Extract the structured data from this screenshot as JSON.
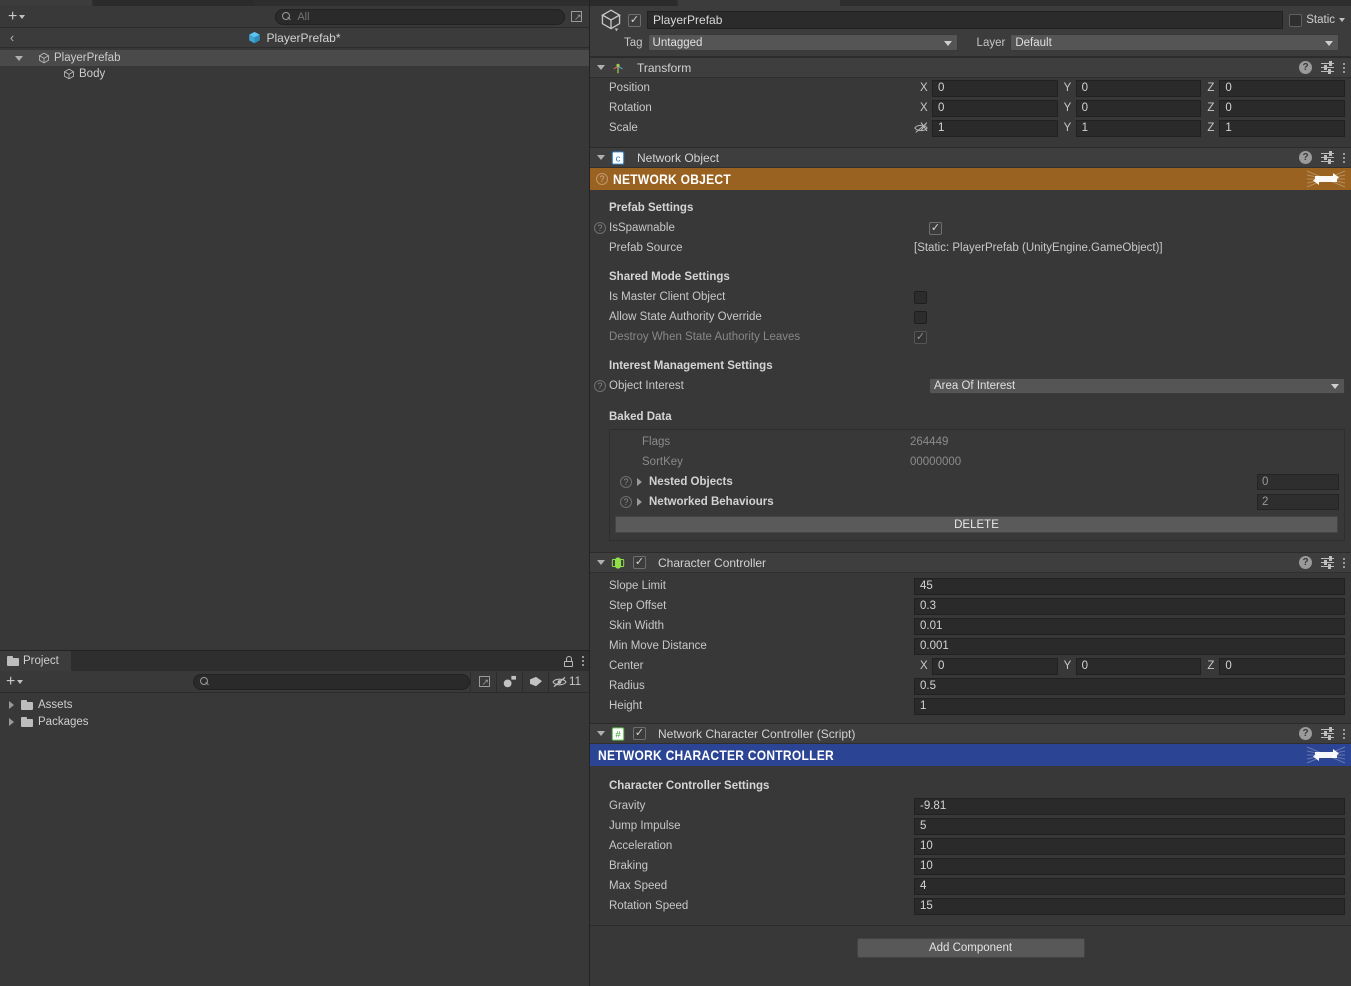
{
  "hierarchy": {
    "search_placeholder": "All",
    "prefab_title": "PlayerPrefab*",
    "back_label": "‹",
    "rows": [
      {
        "label": "PlayerPrefab",
        "icon": "cube-icon",
        "selected": true,
        "expanded": true
      },
      {
        "label": "Body",
        "icon": "cube-icon",
        "selected": false,
        "expanded": false
      }
    ]
  },
  "project": {
    "tab_label": "Project",
    "search_placeholder": "",
    "hidden_count": "11",
    "rows": [
      {
        "label": "Assets"
      },
      {
        "label": "Packages"
      }
    ]
  },
  "inspector": {
    "gameobject": {
      "name": "PlayerPrefab",
      "enabled": true,
      "static_label": "Static",
      "static_checked": false,
      "tag_label": "Tag",
      "tag_value": "Untagged",
      "layer_label": "Layer",
      "layer_value": "Default"
    },
    "components": [
      {
        "id": "transform",
        "title": "Transform",
        "icon": "transform-icon",
        "has_checkbox": false,
        "rows": [
          {
            "label": "Position",
            "type": "vec3",
            "x": "0",
            "y": "0",
            "z": "0"
          },
          {
            "label": "Rotation",
            "type": "vec3",
            "x": "0",
            "y": "0",
            "z": "0"
          },
          {
            "label": "Scale",
            "type": "vec3",
            "x": "1",
            "y": "1",
            "z": "1",
            "lock_icon": true
          }
        ]
      },
      {
        "id": "network-object",
        "title": "Network Object",
        "icon": "script-blue-icon",
        "has_checkbox": false,
        "band": {
          "text": "NETWORK OBJECT",
          "color": "#9a6220",
          "logo": "fusion-logo-icon"
        },
        "groups": [
          {
            "heading": "Prefab Settings",
            "rows": [
              {
                "label": "IsSpawnable",
                "type": "checkbox",
                "checked": true,
                "help": true
              },
              {
                "label": "Prefab Source",
                "type": "static",
                "value": "[Static: PlayerPrefab (UnityEngine.GameObject)]"
              }
            ]
          },
          {
            "heading": "Shared Mode Settings",
            "rows": [
              {
                "label": "Is Master Client Object",
                "type": "checkbox",
                "checked": false
              },
              {
                "label": "Allow State Authority Override",
                "type": "checkbox",
                "checked": false
              },
              {
                "label": "Destroy When State Authority Leaves",
                "type": "checkbox",
                "checked": true,
                "disabled": true
              }
            ]
          },
          {
            "heading": "Interest Management Settings",
            "rows": [
              {
                "label": "Object Interest",
                "type": "dropdown",
                "value": "Area Of Interest",
                "help": true
              }
            ]
          },
          {
            "heading": "Baked Data",
            "boxed": true,
            "rows": [
              {
                "label": "Flags",
                "type": "readonly",
                "value": "264449"
              },
              {
                "label": "SortKey",
                "type": "readonly",
                "value": "00000000"
              },
              {
                "label": "Nested Objects",
                "type": "foldout-count",
                "value": "0",
                "help": true
              },
              {
                "label": "Networked Behaviours",
                "type": "foldout-count",
                "value": "2",
                "help": true
              }
            ],
            "button": "DELETE"
          }
        ]
      },
      {
        "id": "character-controller",
        "title": "Character Controller",
        "icon": "capsule-green-icon",
        "has_checkbox": true,
        "checked": true,
        "rows": [
          {
            "label": "Slope Limit",
            "type": "field",
            "value": "45"
          },
          {
            "label": "Step Offset",
            "type": "field",
            "value": "0.3"
          },
          {
            "label": "Skin Width",
            "type": "field",
            "value": "0.01"
          },
          {
            "label": "Min Move Distance",
            "type": "field",
            "value": "0.001"
          },
          {
            "label": "Center",
            "type": "vec3",
            "x": "0",
            "y": "0",
            "z": "0"
          },
          {
            "label": "Radius",
            "type": "field",
            "value": "0.5"
          },
          {
            "label": "Height",
            "type": "field",
            "value": "1"
          }
        ]
      },
      {
        "id": "network-character-controller",
        "title": "Network Character Controller (Script)",
        "icon": "script-green-icon",
        "has_checkbox": true,
        "checked": true,
        "band": {
          "text": "NETWORK CHARACTER CONTROLLER",
          "color": "#2b4494",
          "logo": "fusion-logo-icon"
        },
        "groups": [
          {
            "heading": "Character Controller Settings",
            "rows": [
              {
                "label": "Gravity",
                "type": "field",
                "value": "-9.81"
              },
              {
                "label": "Jump Impulse",
                "type": "field",
                "value": "5"
              },
              {
                "label": "Acceleration",
                "type": "field",
                "value": "10"
              },
              {
                "label": "Braking",
                "type": "field",
                "value": "10"
              },
              {
                "label": "Max Speed",
                "type": "field",
                "value": "4"
              },
              {
                "label": "Rotation Speed",
                "type": "field",
                "value": "15"
              }
            ]
          }
        ]
      }
    ],
    "add_component_label": "Add Component"
  }
}
